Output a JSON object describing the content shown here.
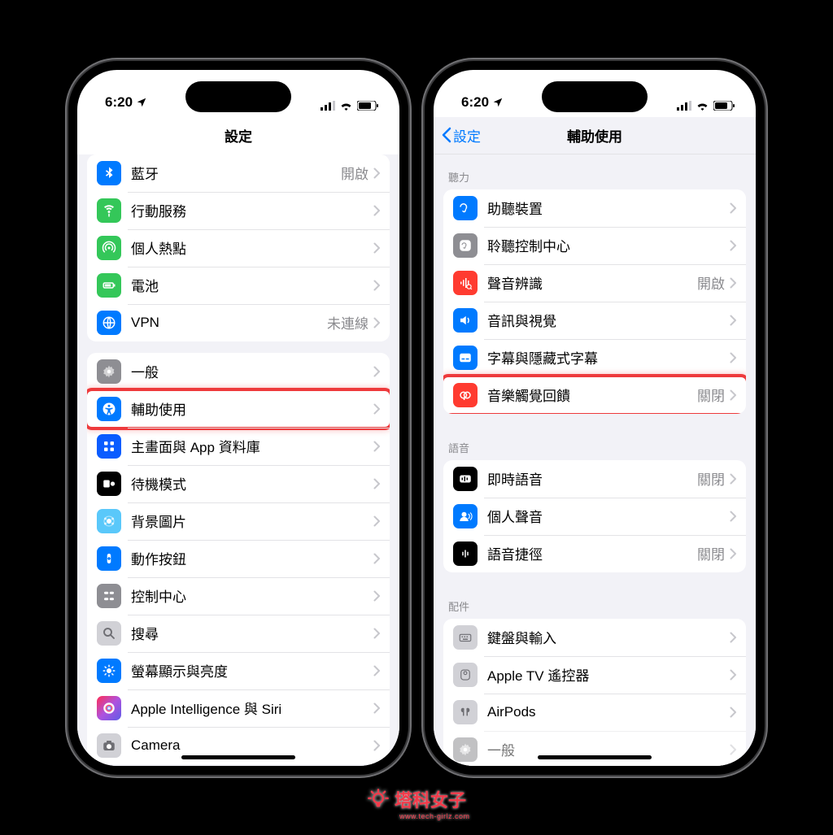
{
  "status": {
    "time": "6:20"
  },
  "left": {
    "nav_title": "設定",
    "group1": [
      {
        "icon": "bluetooth-icon",
        "bg": "bg-blue",
        "label": "藍牙",
        "value": "開啟"
      },
      {
        "icon": "antenna-icon",
        "bg": "bg-green",
        "label": "行動服務",
        "value": ""
      },
      {
        "icon": "hotspot-icon",
        "bg": "bg-green",
        "label": "個人熱點",
        "value": ""
      },
      {
        "icon": "battery-icon",
        "bg": "bg-green",
        "label": "電池",
        "value": ""
      },
      {
        "icon": "vpn-icon",
        "bg": "bg-blue",
        "label": "VPN",
        "value": "未連線"
      }
    ],
    "group2": [
      {
        "icon": "gear-icon",
        "bg": "bg-gray",
        "label": "一般"
      },
      {
        "icon": "accessibility-icon",
        "bg": "bg-blue",
        "label": "輔助使用",
        "highlight": true
      },
      {
        "icon": "appgrid-icon",
        "bg": "bg-blueD",
        "label": "主畫面與 App 資料庫"
      },
      {
        "icon": "standby-icon",
        "bg": "bg-black",
        "label": "待機模式"
      },
      {
        "icon": "wallpaper-icon",
        "bg": "bg-teal",
        "label": "背景圖片"
      },
      {
        "icon": "action-icon",
        "bg": "bg-blue",
        "label": "動作按鈕"
      },
      {
        "icon": "control-icon",
        "bg": "bg-gray",
        "label": "控制中心"
      },
      {
        "icon": "search-icon",
        "bg": "bg-grayL",
        "label": "搜尋"
      },
      {
        "icon": "brightness-icon",
        "bg": "bg-blue",
        "label": "螢幕顯示與亮度"
      },
      {
        "icon": "siri-icon",
        "bg": "bg-purple",
        "label": "Apple Intelligence 與 Siri"
      },
      {
        "icon": "camera-icon",
        "bg": "bg-grayL",
        "label": "Camera"
      }
    ]
  },
  "right": {
    "nav_back": "設定",
    "nav_title": "輔助使用",
    "section1_title": "聽力",
    "group1": [
      {
        "icon": "ear-icon",
        "bg": "bg-blue",
        "label": "助聽裝置"
      },
      {
        "icon": "hearctrl-icon",
        "bg": "bg-gray",
        "label": "聆聽控制中心"
      },
      {
        "icon": "soundrec-icon",
        "bg": "bg-red",
        "label": "聲音辨識",
        "value": "開啟"
      },
      {
        "icon": "audiovis-icon",
        "bg": "bg-blue",
        "label": "音訊與視覺"
      },
      {
        "icon": "subtitle-icon",
        "bg": "bg-blue",
        "label": "字幕與隱藏式字幕"
      },
      {
        "icon": "haptic-icon",
        "bg": "bg-red",
        "label": "音樂觸覺回饋",
        "value": "關閉",
        "highlight": true
      }
    ],
    "section2_title": "語音",
    "group2": [
      {
        "icon": "livevoice-icon",
        "bg": "bg-black",
        "label": "即時語音",
        "value": "關閉"
      },
      {
        "icon": "personvoice-icon",
        "bg": "bg-blue",
        "label": "個人聲音"
      },
      {
        "icon": "voiceshortcut-icon",
        "bg": "bg-black",
        "label": "語音捷徑",
        "value": "關閉"
      }
    ],
    "section3_title": "配件",
    "group3": [
      {
        "icon": "keyboard-icon",
        "bg": "bg-grayL",
        "label": "鍵盤與輸入"
      },
      {
        "icon": "appletv-icon",
        "bg": "bg-grayL",
        "label": "Apple TV 遙控器"
      },
      {
        "icon": "airpods-icon",
        "bg": "bg-grayL",
        "label": "AirPods"
      },
      {
        "icon": "general2-icon",
        "bg": "bg-gray",
        "label": "一般",
        "partial": true
      }
    ]
  },
  "watermark": {
    "text": "塔科女子",
    "sub": "www.tech-girlz.com"
  }
}
